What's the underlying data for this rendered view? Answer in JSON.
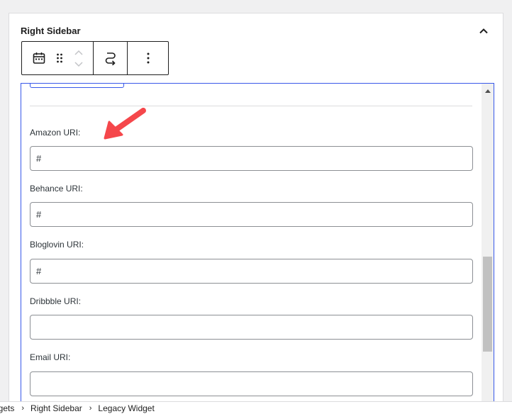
{
  "panel": {
    "title": "Right Sidebar"
  },
  "icons": {
    "collapse": "chevron-up-icon",
    "block_type": "calendar-icon",
    "drag": "drag-handle-icon",
    "move_up": "chevron-up-icon",
    "move_down": "chevron-down-icon",
    "transform": "transform-icon",
    "more": "more-vertical-icon"
  },
  "fields": [
    {
      "label": "Amazon URI:",
      "value": "#"
    },
    {
      "label": "Behance URI:",
      "value": "#"
    },
    {
      "label": "Bloglovin URI:",
      "value": "#"
    },
    {
      "label": "Dribbble URI:",
      "value": ""
    },
    {
      "label": "Email URI:",
      "value": ""
    }
  ],
  "breadcrumb": {
    "items": [
      "dgets",
      "Right Sidebar",
      "Legacy Widget"
    ],
    "separator": "›"
  },
  "colors": {
    "accent": "#3858e9",
    "annotation_arrow": "#f5474b",
    "border": "#dcdcde"
  }
}
